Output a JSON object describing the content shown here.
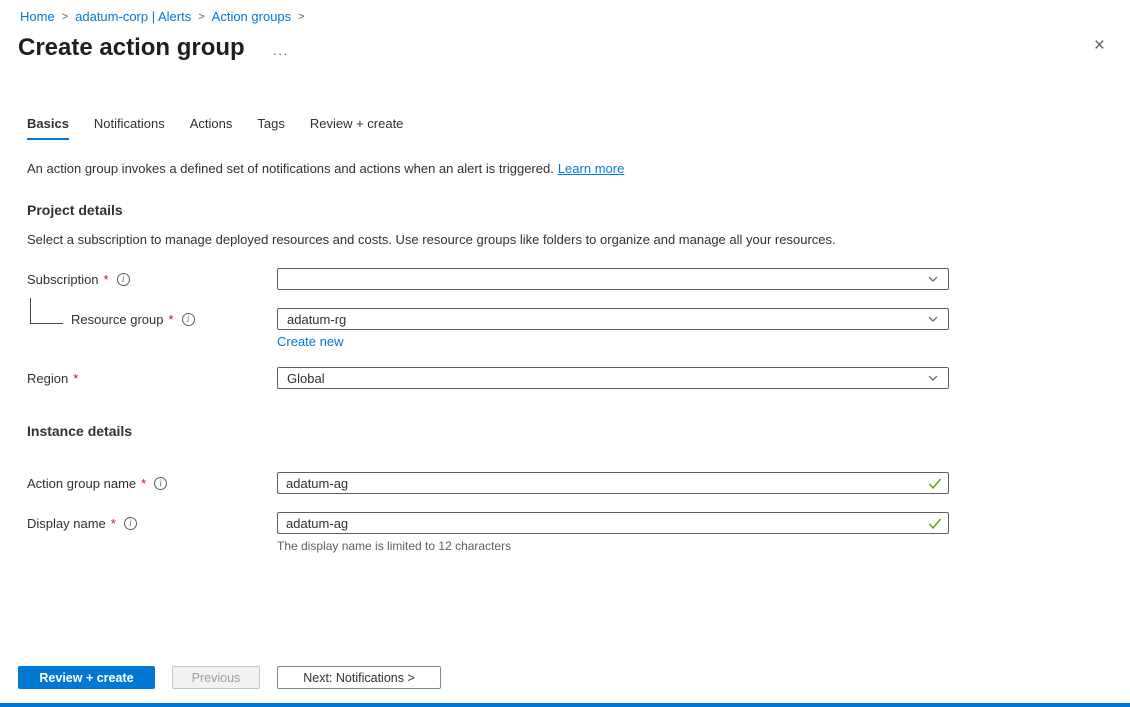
{
  "breadcrumb": {
    "separator": ">",
    "items": [
      {
        "label": "Home"
      },
      {
        "label": "adatum-corp | Alerts"
      },
      {
        "label": "Action groups"
      }
    ]
  },
  "header": {
    "title": "Create action group",
    "icons": {
      "more": "···",
      "close": "×"
    }
  },
  "icons": {
    "info": "i"
  },
  "tabs": [
    {
      "label": "Basics",
      "active": true
    },
    {
      "label": "Notifications",
      "active": false
    },
    {
      "label": "Actions",
      "active": false
    },
    {
      "label": "Tags",
      "active": false
    },
    {
      "label": "Review + create",
      "active": false
    }
  ],
  "intro": {
    "text": "An action group invokes a defined set of notifications and actions when an alert is triggered.",
    "link_label": "Learn more"
  },
  "project_details": {
    "heading": "Project details",
    "description": "Select a subscription to manage deployed resources and costs. Use resource groups like folders to organize and manage all your resources.",
    "fields": {
      "subscription": {
        "label": "Subscription",
        "required_mark": "*",
        "value": ""
      },
      "resource_group": {
        "label": "Resource group",
        "required_mark": "*",
        "value": "adatum-rg",
        "create_new_label": "Create new"
      },
      "region": {
        "label": "Region",
        "required_mark": "*",
        "value": "Global"
      }
    }
  },
  "instance_details": {
    "heading": "Instance details",
    "fields": {
      "action_group_name": {
        "label": "Action group name",
        "required_mark": "*",
        "value": "adatum-ag"
      },
      "display_name": {
        "label": "Display name",
        "required_mark": "*",
        "value": "adatum-ag",
        "helper": "The display name is limited to 12 characters"
      }
    }
  },
  "footer": {
    "buttons": [
      {
        "label": "Review + create",
        "style": "primary"
      },
      {
        "label": "Previous",
        "style": "disabled"
      },
      {
        "label": "Next: Notifications >",
        "style": "secondary"
      }
    ]
  },
  "colors": {
    "accent": "#0078d4",
    "valid_green": "#57a300",
    "required_red": "#c50f1f"
  }
}
